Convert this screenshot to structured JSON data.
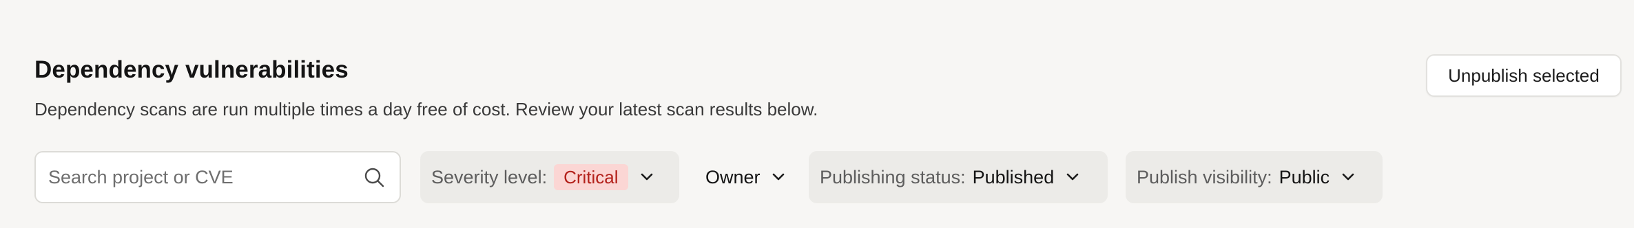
{
  "header": {
    "title": "Dependency vulnerabilities",
    "subtitle": "Dependency scans are run multiple times a day free of cost. Review your latest scan results below.",
    "unpublish_label": "Unpublish selected"
  },
  "filters": {
    "search": {
      "placeholder": "Search project or CVE",
      "value": "",
      "icon": "search-icon"
    },
    "severity": {
      "label": "Severity level:",
      "value": "Critical",
      "badge_bg": "#fbd6d4",
      "badge_fg": "#b3201a"
    },
    "owner": {
      "label": "Owner"
    },
    "publishing_status": {
      "label": "Publishing status:",
      "value": "Published"
    },
    "publish_visibility": {
      "label": "Publish visibility:",
      "value": "Public"
    },
    "chevron_icon": "chevron-down-icon"
  },
  "colors": {
    "background": "#f7f6f4",
    "chip_bg": "#ecebe8",
    "text": "#141414",
    "muted": "#5d5d5d"
  }
}
